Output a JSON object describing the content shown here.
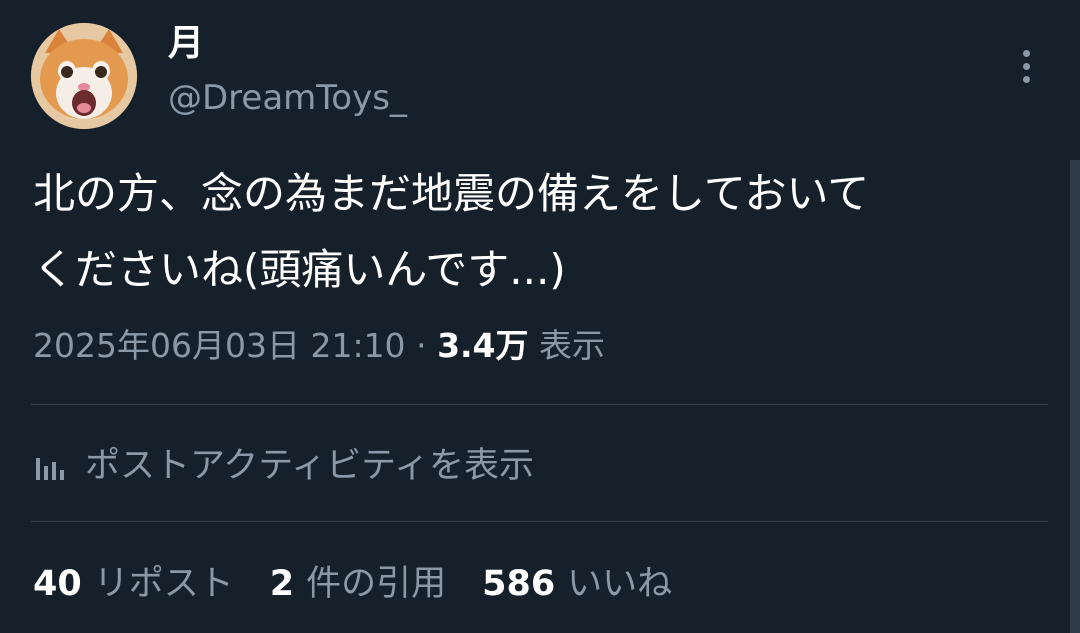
{
  "colors": {
    "background": "#15202b",
    "text_primary": "#ffffff",
    "text_secondary": "#8b98a5",
    "divider": "#38444d"
  },
  "author": {
    "display_name": "月",
    "handle": "@DreamToys_",
    "avatar_icon": "cat-avatar"
  },
  "menu": {
    "icon": "more-vertical-icon"
  },
  "tweet": {
    "text": "北の方、念の為まだ地震の備えをしておいて\nくださいね(頭痛いんです...)",
    "timestamp": "2025年06月03日 21:10",
    "separator": "·",
    "views_count": "3.4万",
    "views_label": "表示"
  },
  "activity": {
    "icon": "bar-chart-icon",
    "label": "ポストアクティビティを表示"
  },
  "stats": {
    "reposts": {
      "count": "40",
      "label": "リポスト"
    },
    "quotes": {
      "count": "2",
      "label": "件の引用"
    },
    "likes": {
      "count": "586",
      "label": "いいね"
    }
  }
}
